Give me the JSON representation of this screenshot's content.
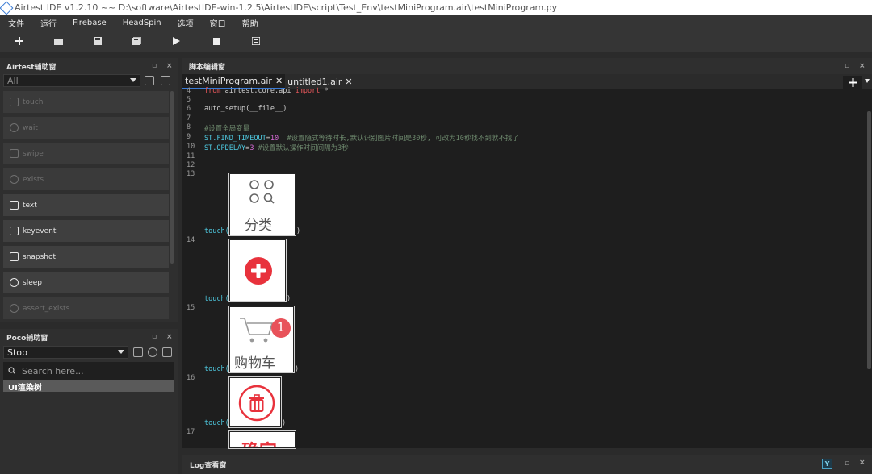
{
  "window": {
    "title": "Airtest IDE v1.2.10 ~~ D:\\software\\AirtestIDE-win-1.2.5\\AirtestIDE\\script\\Test_Env\\testMiniProgram.air\\testMiniProgram.py"
  },
  "menu": [
    "文件",
    "运行",
    "Firebase",
    "HeadSpin",
    "选项",
    "窗口",
    "帮助"
  ],
  "toolbar": {
    "icons": [
      "plus-icon",
      "folder-icon",
      "save-icon",
      "save-all-icon",
      "play-icon",
      "stop-icon",
      "list-icon"
    ]
  },
  "airtest_panel": {
    "title": "Airtest辅助窗",
    "filter_value": "All",
    "buttons": [
      {
        "label": "touch",
        "enabled": false,
        "icon": "hand-icon"
      },
      {
        "label": "wait",
        "enabled": false,
        "icon": "clock-icon"
      },
      {
        "label": "swipe",
        "enabled": false,
        "icon": "swipe-icon"
      },
      {
        "label": "exists",
        "enabled": false,
        "icon": "check-icon"
      },
      {
        "label": "text",
        "enabled": true,
        "icon": "text-icon"
      },
      {
        "label": "keyevent",
        "enabled": true,
        "icon": "keyboard-icon"
      },
      {
        "label": "snapshot",
        "enabled": true,
        "icon": "camera-icon"
      },
      {
        "label": "sleep",
        "enabled": true,
        "icon": "sleep-icon"
      },
      {
        "label": "assert_exists",
        "enabled": false,
        "icon": "target-icon"
      }
    ]
  },
  "poco_panel": {
    "title": "Poco辅助窗",
    "mode_value": "Stop",
    "search_placeholder": "Search here...",
    "tree_root": "UI渲染树"
  },
  "editor_panel": {
    "title": "脚本编辑窗",
    "tabs": [
      {
        "label": "testMiniProgram.air",
        "active": true
      },
      {
        "label": "untitled1.air",
        "active": false
      }
    ],
    "line_numbers": [
      "4",
      "5",
      "6",
      "7",
      "8",
      "9",
      "10",
      "11",
      "12",
      "13",
      "14",
      "15",
      "16",
      "17"
    ],
    "code": {
      "l4_from": "from",
      "l4_mod": " airtest.core.api ",
      "l4_import": "import",
      "l4_star": " *",
      "l6": "auto_setup(__file__)",
      "l8": "#设置全局变量",
      "l9_var": "ST.FIND_TIMEOUT",
      "l9_eq": "=",
      "l9_val": "10",
      "l9_cmt": "  #设置隐式等待时长,默认识别图片时间是30秒, 可改为10秒找不到就不找了",
      "l10_var": "ST.OPDELAY",
      "l10_eq": "=",
      "l10_val": "3",
      "l10_cmt": " #设置默认操作时间间隔为3秒",
      "touch_fn": "touch(",
      "close_paren": ")"
    },
    "images": [
      {
        "name": "classify-image",
        "caption": "分类"
      },
      {
        "name": "add-red-image",
        "caption": ""
      },
      {
        "name": "cart-image",
        "caption": "购物车",
        "badge": "1"
      },
      {
        "name": "delete-image",
        "caption": ""
      },
      {
        "name": "confirm-image",
        "caption": "确定"
      }
    ],
    "accent_red": "#e8323c"
  },
  "log_panel": {
    "title": "Log查看窗"
  }
}
